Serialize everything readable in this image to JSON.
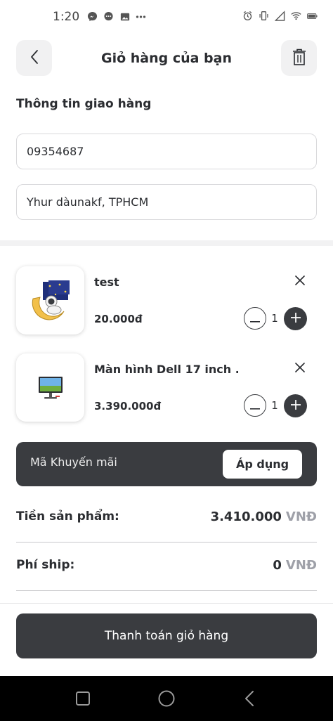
{
  "status_bar": {
    "time": "1:20",
    "left_icons": [
      "messenger-icon",
      "chat-bubble-icon",
      "image-icon",
      "more-dots-icon"
    ],
    "right_icons": [
      "alarm-icon",
      "vibrate-icon",
      "signal-icon",
      "wifi-icon",
      "battery-icon"
    ]
  },
  "header": {
    "title": "Giỏ hàng của bạn",
    "back_icon": "chevron-left-icon",
    "trash_icon": "trash-icon"
  },
  "shipping": {
    "section_title": "Thông tin giao hàng",
    "phone_value": "09354687",
    "address_value": "Yhur dàunakf, TPHCM"
  },
  "cart": {
    "items": [
      {
        "name": "test",
        "price": "20.000đ",
        "quantity": "1",
        "thumbnail_icon": "astronaut-moon-image"
      },
      {
        "name": "Màn hình Dell 17 inch ...",
        "price": "3.390.000đ",
        "quantity": "1",
        "thumbnail_icon": "monitor-image"
      }
    ]
  },
  "promo": {
    "placeholder": "Mã Khuyến mãi",
    "apply_label": "Áp dụng"
  },
  "summary": {
    "subtotal_label": "Tiền sản phẩm:",
    "subtotal_value": "3.410.000",
    "subtotal_unit": "VNĐ",
    "shipping_label": "Phí ship:",
    "shipping_value": "0",
    "shipping_unit": "VNĐ"
  },
  "checkout": {
    "label": "Thanh toán giỏ hàng"
  },
  "nav_bar": {
    "buttons": [
      "recents-square-icon",
      "home-circle-icon",
      "back-triangle-icon"
    ]
  },
  "colors": {
    "accent_dark": "#3a3c40",
    "muted_unit": "#9ea0a8",
    "background": "#ffffff"
  }
}
